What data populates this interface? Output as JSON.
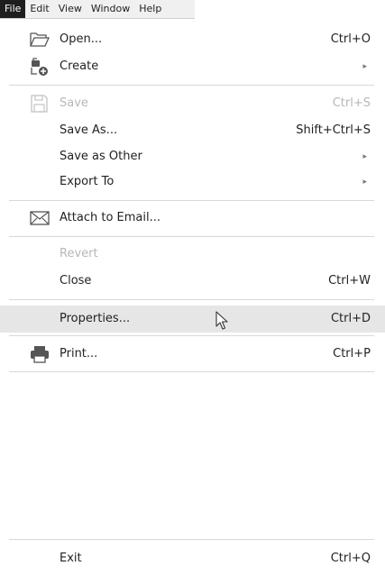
{
  "menubar": [
    "File",
    "Edit",
    "View",
    "Window",
    "Help"
  ],
  "items": {
    "open": {
      "label": "Open...",
      "shortcut": "Ctrl+O"
    },
    "create": {
      "label": "Create"
    },
    "save": {
      "label": "Save",
      "shortcut": "Ctrl+S"
    },
    "save_as": {
      "label": "Save As...",
      "shortcut": "Shift+Ctrl+S"
    },
    "save_other": {
      "label": "Save as Other"
    },
    "export": {
      "label": "Export To"
    },
    "attach": {
      "label": "Attach to Email..."
    },
    "revert": {
      "label": "Revert"
    },
    "close": {
      "label": "Close",
      "shortcut": "Ctrl+W"
    },
    "properties": {
      "label": "Properties...",
      "shortcut": "Ctrl+D"
    },
    "print": {
      "label": "Print...",
      "shortcut": "Ctrl+P"
    },
    "exit": {
      "label": "Exit",
      "shortcut": "Ctrl+Q"
    }
  },
  "submenu_arrow": "▸",
  "icons": {
    "open": "folder-open-icon",
    "create": "create-pdf-icon",
    "save": "save-icon",
    "attach": "envelope-icon",
    "print": "printer-icon"
  }
}
